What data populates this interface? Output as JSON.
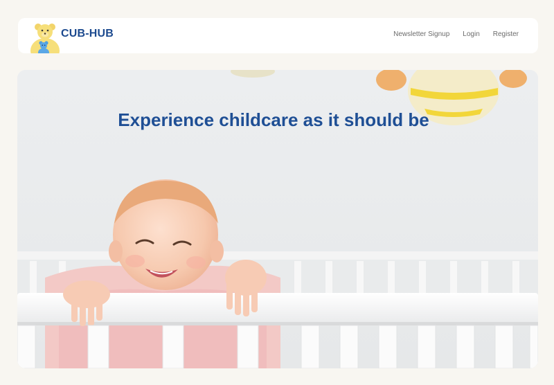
{
  "app": {
    "brand_name": "CUB-HUB"
  },
  "nav": {
    "links": [
      {
        "label": "Newsletter Signup"
      },
      {
        "label": "Login"
      },
      {
        "label": "Register"
      }
    ]
  },
  "hero": {
    "headline": "Experience childcare as it should be"
  },
  "colors": {
    "brand": "#1c4a8f",
    "headline": "#1f4f95",
    "page_bg": "#f8f6f1",
    "nav_text": "#6b6b6b",
    "logo_bear_yellow": "#f6df7a",
    "logo_bear_blue": "#5aa7e6"
  },
  "icons": {
    "logo": "bear-logo-icon"
  }
}
